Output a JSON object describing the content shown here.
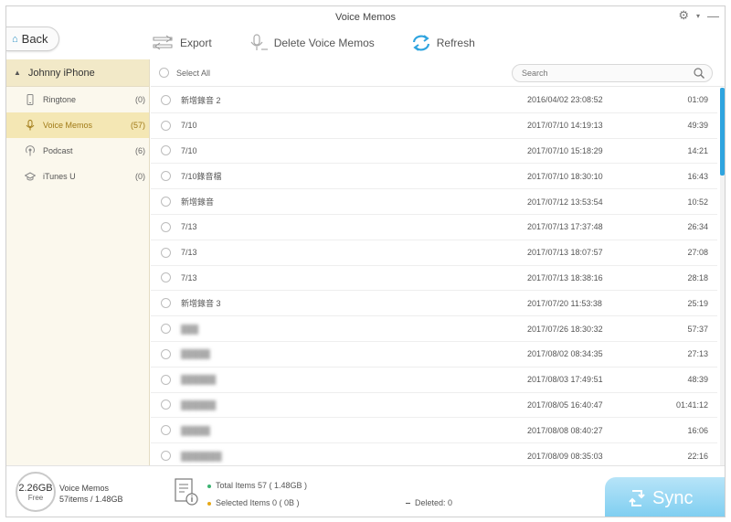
{
  "window": {
    "title": "Voice Memos"
  },
  "toolbar": {
    "back_label": "Back",
    "export_label": "Export",
    "delete_label": "Delete Voice Memos",
    "refresh_label": "Refresh"
  },
  "sidebar": {
    "device_name": "Johnny  iPhone",
    "items": [
      {
        "label": "Ringtone",
        "count": "(0)",
        "icon": "phone-icon"
      },
      {
        "label": "Voice Memos",
        "count": "(57)",
        "icon": "microphone-icon"
      },
      {
        "label": "Podcast",
        "count": "(6)",
        "icon": "podcast-icon"
      },
      {
        "label": "iTunes U",
        "count": "(0)",
        "icon": "graduation-cap-icon"
      }
    ]
  },
  "list": {
    "select_all_label": "Select All",
    "search_placeholder": "Search",
    "rows": [
      {
        "name": "新增錄音 2",
        "date": "2016/04/02 23:08:52",
        "duration": "01:09",
        "blurred": false
      },
      {
        "name": "7/10",
        "date": "2017/07/10 14:19:13",
        "duration": "49:39",
        "blurred": false
      },
      {
        "name": "7/10",
        "date": "2017/07/10 15:18:29",
        "duration": "14:21",
        "blurred": false
      },
      {
        "name": "7/10錄音檔",
        "date": "2017/07/10 18:30:10",
        "duration": "16:43",
        "blurred": false
      },
      {
        "name": "新增錄音",
        "date": "2017/07/12 13:53:54",
        "duration": "10:52",
        "blurred": false
      },
      {
        "name": "7/13",
        "date": "2017/07/13 17:37:48",
        "duration": "26:34",
        "blurred": false
      },
      {
        "name": "7/13",
        "date": "2017/07/13 18:07:57",
        "duration": "27:08",
        "blurred": false
      },
      {
        "name": "7/13",
        "date": "2017/07/13 18:38:16",
        "duration": "28:18",
        "blurred": false
      },
      {
        "name": "新增錄音 3",
        "date": "2017/07/20 11:53:38",
        "duration": "25:19",
        "blurred": false
      },
      {
        "name": "███",
        "date": "2017/07/26 18:30:32",
        "duration": "57:37",
        "blurred": true
      },
      {
        "name": "█████",
        "date": "2017/08/02 08:34:35",
        "duration": "27:13",
        "blurred": true
      },
      {
        "name": "██████",
        "date": "2017/08/03 17:49:51",
        "duration": "48:39",
        "blurred": true
      },
      {
        "name": "██████",
        "date": "2017/08/05 16:40:47",
        "duration": "01:41:12",
        "blurred": true
      },
      {
        "name": "█████",
        "date": "2017/08/08 08:40:27",
        "duration": "16:06",
        "blurred": true
      },
      {
        "name": "███████",
        "date": "2017/08/09 08:35:03",
        "duration": "22:16",
        "blurred": true
      }
    ]
  },
  "footer": {
    "storage_free": "2.26GB",
    "storage_free_label": "Free",
    "category_name": "Voice Memos",
    "category_size": "57items / 1.48GB",
    "total_items": "Total Items  57 ( 1.48GB )",
    "selected_items": "Selected Items  0  ( 0B )",
    "deleted": "Deleted:  0",
    "sync_label": "Sync"
  },
  "colors": {
    "accent_blue": "#2fa4df",
    "sidebar_bg": "#fbf8ed",
    "active_item_bg": "#f4e7b4",
    "total_dot": "#3cb371",
    "selected_dot": "#e6a817"
  }
}
